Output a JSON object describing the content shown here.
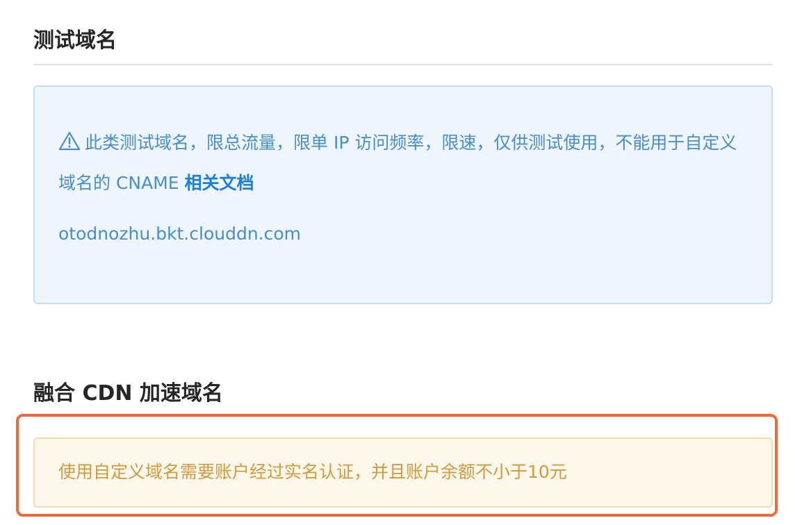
{
  "test_domain_section": {
    "title": "测试域名",
    "notice": {
      "icon": "warning-triangle-icon",
      "text": "此类测试域名，限总流量，限单 IP 访问频率，限速，仅供测试使用，不能用于自定义域名的 CNAME",
      "link_label": "相关文档"
    },
    "domain": "otodnozhu.bkt.clouddn.com"
  },
  "cdn_domain_section": {
    "title": "融合 CDN 加速域名",
    "notice": {
      "text": "使用自定义域名需要账户经过实名认证，并且账户余额不小于10元"
    }
  },
  "colors": {
    "info_text": "#4a8ec9",
    "info_bg": "#eef5fd",
    "link": "#1a7ee0",
    "warn_text": "#d19a3d",
    "warn_bg": "#fef8ec",
    "highlight_border": "#ef6c3a"
  }
}
